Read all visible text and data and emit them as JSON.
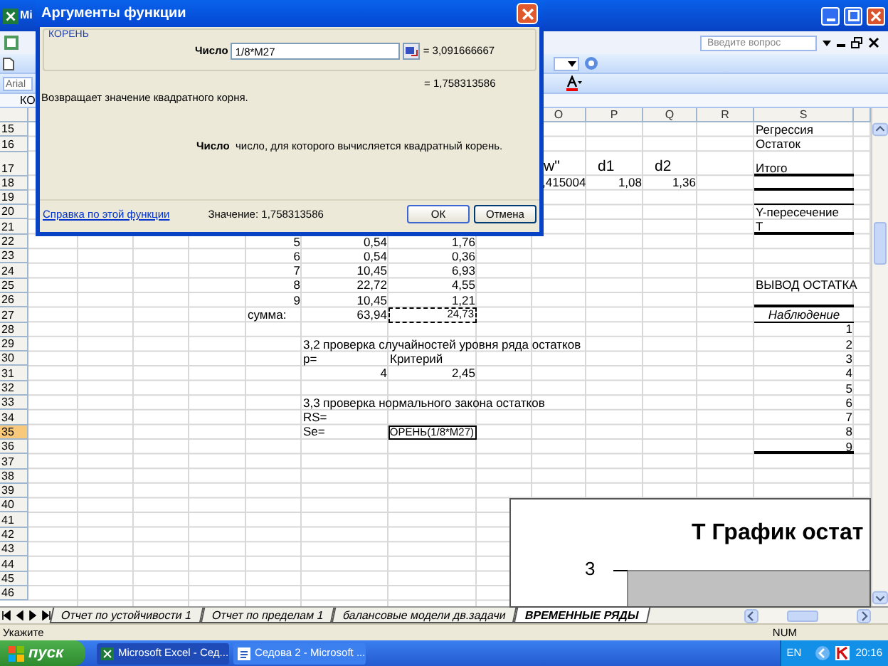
{
  "excel_title": "Mi",
  "help_search": {
    "placeholder": "Введите вопрос"
  },
  "font_box": "Arial",
  "name_box": "КО",
  "column_headers": [
    "O",
    "P",
    "Q",
    "R",
    "S"
  ],
  "rows": [
    {
      "number": "15",
      "selected": false,
      "cells": {
        "S": {
          "text": "Регрессия",
          "kind": "text",
          "selected": false
        }
      }
    },
    {
      "number": "16",
      "selected": false,
      "cells": {
        "S": {
          "text": "Остаток",
          "kind": "text",
          "selected": false
        }
      }
    },
    {
      "number": "17",
      "selected": false,
      "cells": {
        "O": {
          "text": "w\"",
          "kind": "big",
          "selected": false
        },
        "P": {
          "text": "d1",
          "kind": "big",
          "selected": false
        },
        "Q": {
          "text": "d2",
          "kind": "big",
          "selected": false
        },
        "S": {
          "text": "Итого",
          "kind": "text",
          "rule_below": true,
          "rule_heavy": true,
          "selected": false
        }
      }
    },
    {
      "number": "18",
      "selected": false,
      "cells": {
        "O": {
          "text": ",415004",
          "kind": "text",
          "selected": false
        },
        "P": {
          "text": "1,08",
          "kind": "number",
          "selected": false
        },
        "Q": {
          "text": "1,36",
          "kind": "number",
          "selected": false
        },
        "S": {
          "rule_below": true,
          "rule_heavy": true,
          "selected": false
        }
      }
    },
    {
      "number": "19",
      "selected": false,
      "cells": {
        "S": {
          "rule_below": true,
          "rule_heavy": false,
          "selected": false
        }
      }
    },
    {
      "number": "20",
      "selected": false,
      "cells": {
        "S": {
          "text": "Y-пересечение",
          "kind": "text",
          "selected": false
        }
      }
    },
    {
      "number": "21",
      "selected": false,
      "cells": {
        "S": {
          "text": "T",
          "kind": "text",
          "rule_below": true,
          "rule_heavy": true,
          "selected": false
        }
      }
    },
    {
      "number": "22",
      "selected": false,
      "cells": {
        "E": {
          "text": "5",
          "kind": "number",
          "selected": false
        },
        "F": {
          "text": "0,54",
          "kind": "number",
          "selected": false
        },
        "G": {
          "text": "1,76",
          "kind": "number",
          "selected": false
        }
      }
    },
    {
      "number": "23",
      "selected": false,
      "cells": {
        "E": {
          "text": "6",
          "kind": "number",
          "selected": false
        },
        "F": {
          "text": "0,54",
          "kind": "number",
          "selected": false
        },
        "G": {
          "text": "0,36",
          "kind": "number",
          "selected": false
        }
      }
    },
    {
      "number": "24",
      "selected": false,
      "cells": {
        "E": {
          "text": "7",
          "kind": "number",
          "selected": false
        },
        "F": {
          "text": "10,45",
          "kind": "number",
          "selected": false
        },
        "G": {
          "text": "6,93",
          "kind": "number",
          "selected": false
        }
      }
    },
    {
      "number": "25",
      "selected": false,
      "cells": {
        "E": {
          "text": "8",
          "kind": "number",
          "selected": false
        },
        "F": {
          "text": "22,72",
          "kind": "number",
          "selected": false
        },
        "G": {
          "text": "4,55",
          "kind": "number",
          "selected": false
        },
        "S": {
          "text": "ВЫВОД ОСТАТКА",
          "kind": "text",
          "selected": false
        }
      }
    },
    {
      "number": "26",
      "selected": false,
      "cells": {
        "E": {
          "text": "9",
          "kind": "number",
          "selected": false
        },
        "F": {
          "text": "10,45",
          "kind": "number",
          "selected": false
        },
        "G": {
          "text": "1,21",
          "kind": "number",
          "selected": false
        },
        "S": {
          "rule_below": true,
          "rule_heavy": true,
          "selected": false
        }
      }
    },
    {
      "number": "27",
      "selected": false,
      "cells": {
        "E": {
          "text": "сумма:",
          "kind": "text",
          "selected": false
        },
        "F": {
          "text": "63,94",
          "kind": "number",
          "selected": false
        },
        "G": {
          "text": "24,73",
          "kind": "number",
          "copied": true,
          "selected": false
        },
        "S": {
          "text": "Наблюдение",
          "kind": "heading",
          "rule_below": true,
          "rule_heavy": false,
          "selected": false
        }
      }
    },
    {
      "number": "28",
      "selected": false,
      "cells": {
        "S": {
          "text": "1",
          "kind": "number",
          "selected": false
        }
      }
    },
    {
      "number": "29",
      "selected": false,
      "cells": {
        "F": {
          "text": "3,2 проверка случайностей уровня ряда остатков",
          "kind": "text",
          "selected": false
        },
        "S": {
          "text": "2",
          "kind": "number",
          "selected": false
        }
      }
    },
    {
      "number": "30",
      "selected": false,
      "cells": {
        "F": {
          "text": "p=",
          "kind": "text",
          "selected": false
        },
        "G": {
          "text": "Критерий",
          "kind": "text",
          "selected": false
        },
        "S": {
          "text": "3",
          "kind": "number",
          "selected": false
        }
      }
    },
    {
      "number": "31",
      "selected": false,
      "cells": {
        "F": {
          "text": "4",
          "kind": "number",
          "selected": false
        },
        "G": {
          "text": "2,45",
          "kind": "number",
          "selected": false
        },
        "S": {
          "text": "4",
          "kind": "number",
          "selected": false
        }
      }
    },
    {
      "number": "32",
      "selected": false,
      "cells": {
        "S": {
          "text": "5",
          "kind": "number",
          "selected": false
        }
      }
    },
    {
      "number": "33",
      "selected": false,
      "cells": {
        "F": {
          "text": "3,3 проверка нормального закона остатков",
          "kind": "text",
          "selected": false
        },
        "S": {
          "text": "6",
          "kind": "number",
          "selected": false
        }
      }
    },
    {
      "number": "34",
      "selected": false,
      "cells": {
        "F": {
          "text": "RS=",
          "kind": "text",
          "selected": false
        },
        "S": {
          "text": "7",
          "kind": "number",
          "selected": false
        }
      }
    },
    {
      "number": "35",
      "selected": true,
      "cells": {
        "F": {
          "text": "Se=",
          "kind": "text",
          "selected": false
        },
        "G": {
          "text": "ОРЕНЬ(1/8*M27)",
          "kind": "text",
          "selected": true
        },
        "S": {
          "text": "8",
          "kind": "number",
          "selected": false
        }
      }
    },
    {
      "number": "36",
      "selected": false,
      "cells": {
        "S": {
          "text": "9",
          "kind": "number",
          "rule_below": true,
          "rule_heavy": true,
          "selected": false
        }
      }
    },
    {
      "number": "37",
      "selected": false
    },
    {
      "number": "38",
      "selected": false
    },
    {
      "number": "39",
      "selected": false
    },
    {
      "number": "40",
      "selected": false
    },
    {
      "number": "41",
      "selected": false
    },
    {
      "number": "42",
      "selected": false
    },
    {
      "number": "43",
      "selected": false
    },
    {
      "number": "44",
      "selected": false
    },
    {
      "number": "45",
      "selected": false
    },
    {
      "number": "46",
      "selected": false
    }
  ],
  "chart": {
    "title": "Т График остат",
    "tick": "3"
  },
  "dialog": {
    "title": "Аргументы функции",
    "function_name": "КОРЕНЬ",
    "argument": {
      "label": "Число",
      "value": "1/8*M27",
      "result": "= 3,091666667"
    },
    "formula_result": "= 1,758313586",
    "description": "Возвращает значение квадратного корня.",
    "argument_help": "**Число**  число, для которого вычисляется квадратный корень.",
    "help_link": "Справка по этой функции",
    "value_text": "Значение: 1,758313586",
    "buttons": [
      "ОК",
      "Отмена"
    ]
  },
  "sheet_tabs": [
    {
      "label": "Отчет по устойчивости 1",
      "selected": false
    },
    {
      "label": "Отчет по пределам 1",
      "selected": false
    },
    {
      "label": "балансовые модели дв.задачи",
      "selected": false
    },
    {
      "label": "ВРЕМЕННЫЕ РЯДЫ",
      "selected": true
    }
  ],
  "status_bar": {
    "message": "Укажите",
    "indicator": "NUM"
  },
  "taskbar": {
    "start": "пуск",
    "buttons": [
      {
        "label": "Microsoft Excel - Сед...",
        "kind": "excel",
        "selected": true
      },
      {
        "label": "Седова 2 - Microsoft ...",
        "kind": "word",
        "selected": false
      }
    ],
    "language": "EN",
    "clock": "20:16"
  }
}
